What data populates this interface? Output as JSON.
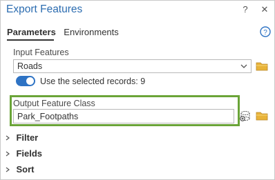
{
  "window": {
    "title": "Export Features",
    "help_button": "?",
    "close_button": "✕"
  },
  "tabs": [
    {
      "label": "Parameters",
      "active": true
    },
    {
      "label": "Environments",
      "active": false
    }
  ],
  "form": {
    "input_features": {
      "label": "Input Features",
      "value": "Roads"
    },
    "selected_records": {
      "label": "Use the selected records: 9",
      "enabled": true
    },
    "output_feature_class": {
      "label": "Output Feature Class",
      "value": "Park_Footpaths"
    }
  },
  "sections": [
    {
      "label": "Filter"
    },
    {
      "label": "Fields"
    },
    {
      "label": "Sort"
    }
  ],
  "colors": {
    "title": "#2b6cb0",
    "toggle_on": "#2e73c4",
    "highlight": "#6aa438",
    "folder": "#e8b339"
  },
  "icons": {
    "help": "help-circle-icon",
    "dropdown": "chevron-down-icon",
    "browse": "folder-icon",
    "database": "geodatabase-icon",
    "expand": "caret-right-icon"
  }
}
